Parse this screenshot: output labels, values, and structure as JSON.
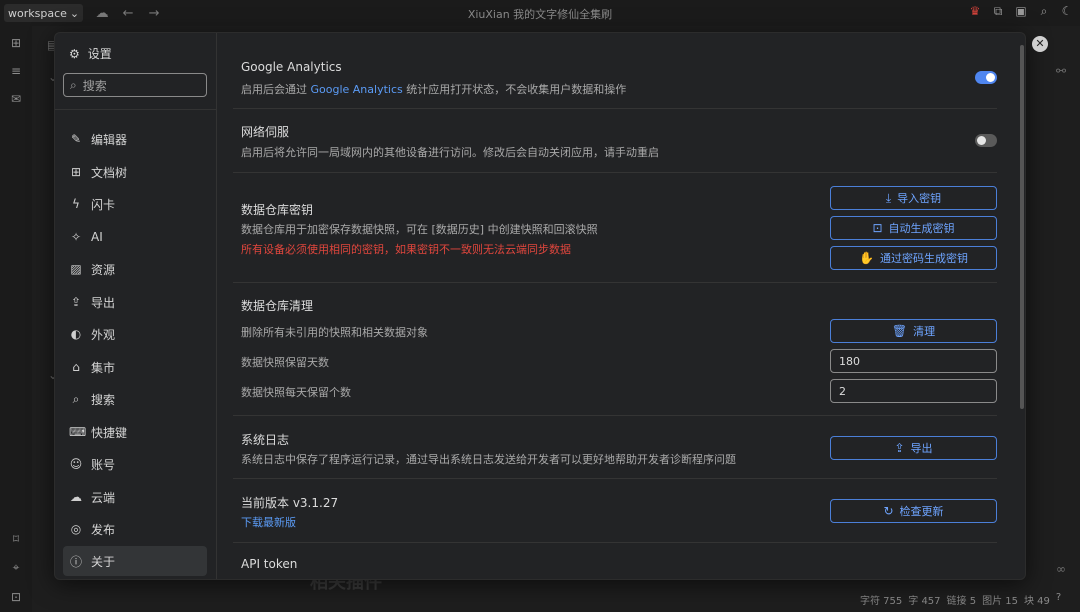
{
  "topbar": {
    "workspace": "workspace",
    "title": "XiuXian 我的文字修仙全集刷",
    "icons": [
      "cloud-icon",
      "back-arrow-icon",
      "forward-arrow-icon"
    ],
    "right_icons": [
      "crown-icon",
      "plugin-icon",
      "layout-icon",
      "search-icon",
      "moon-icon"
    ]
  },
  "dock_icons": [
    "file-tree-icon",
    "outline-icon",
    "inbox-icon",
    "bookmark-icon",
    "tag-icon",
    "dock-toggle-icon"
  ],
  "statusbar": {
    "chars_label": "字符 755",
    "words_label": "字 457",
    "links_label": "链接 5",
    "images_label": "图片 15",
    "blocks_label": "块 49",
    "help": "?"
  },
  "background": {
    "heading_fragment": "相关插件"
  },
  "settings": {
    "title": "设置",
    "search_placeholder": "搜索",
    "nav": [
      {
        "label": "编辑器",
        "icon": "pencil-icon"
      },
      {
        "label": "文档树",
        "icon": "file-tree-icon"
      },
      {
        "label": "闪卡",
        "icon": "lightning-icon"
      },
      {
        "label": "AI",
        "icon": "sparkle-icon"
      },
      {
        "label": "资源",
        "icon": "image-icon"
      },
      {
        "label": "导出",
        "icon": "upload-icon"
      },
      {
        "label": "外观",
        "icon": "palette-icon"
      },
      {
        "label": "集市",
        "icon": "store-icon"
      },
      {
        "label": "搜索",
        "icon": "search-icon"
      },
      {
        "label": "快捷键",
        "icon": "keyboard-icon"
      },
      {
        "label": "账号",
        "icon": "user-icon"
      },
      {
        "label": "云端",
        "icon": "cloud-icon"
      },
      {
        "label": "发布",
        "icon": "globe-icon"
      },
      {
        "label": "关于",
        "icon": "info-icon",
        "active": true
      }
    ],
    "about": {
      "ga": {
        "title": "Google Analytics",
        "desc_prefix": "启用后会通过 ",
        "desc_link": "Google Analytics",
        "desc_suffix": " 统计应用打开状态，不会收集用户数据和操作",
        "enabled": true
      },
      "network": {
        "title": "网络伺服",
        "desc": "启用后将允许同一局域网内的其他设备进行访问。修改后会自动关闭应用，请手动重启",
        "enabled": false
      },
      "repo_key": {
        "title": "数据仓库密钥",
        "desc": "数据仓库用于加密保存数据快照，可在 [数据历史] 中创建快照和回滚快照",
        "warning": "所有设备必须使用相同的密钥，如果密钥不一致则无法云端同步数据",
        "btn_import": "导入密钥",
        "btn_auto": "自动生成密钥",
        "btn_password": "通过密码生成密钥"
      },
      "repo_clean": {
        "title": "数据仓库清理",
        "desc": "删除所有未引用的快照和相关数据对象",
        "btn_clean": "清理",
        "keep_days_label": "数据快照保留天数",
        "keep_days_value": "180",
        "keep_per_day_label": "数据快照每天保留个数",
        "keep_per_day_value": "2"
      },
      "syslog": {
        "title": "系统日志",
        "desc": "系统日志中保存了程序运行记录，通过导出系统日志发送给开发者可以更好地帮助开发者诊断程序问题",
        "btn_export": "导出"
      },
      "version": {
        "title": "当前版本 v3.1.27",
        "download_link": "下载最新版",
        "btn_check": "检查更新"
      },
      "api": {
        "title": "API token"
      }
    }
  }
}
